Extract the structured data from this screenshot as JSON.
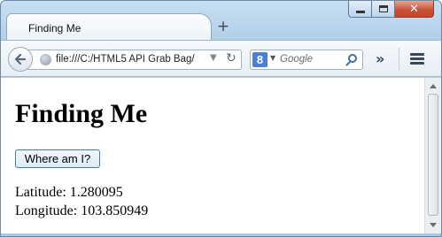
{
  "browser": {
    "tab_title": "Finding Me",
    "new_tab_label": "+",
    "url": "file:///C:/HTML5 API Grab Bag/",
    "search_placeholder": "Google",
    "search_engine_letter": "8"
  },
  "page": {
    "heading": "Finding Me",
    "button_label": "Where am I?",
    "latitude_text": "Latitude: 1.280095",
    "longitude_text": "Longitude: 103.850949"
  },
  "colors": {
    "frame": "#b3d0eb",
    "close_button": "#c74f35",
    "button_border": "#3c7fb1"
  },
  "icons": [
    "minimize-icon",
    "maximize-icon",
    "close-icon",
    "back-arrow-icon",
    "globe-icon",
    "dropdown-arrow-icon",
    "reload-icon",
    "google-logo-icon",
    "search-icon",
    "overflow-chevron-icon",
    "menu-icon"
  ]
}
